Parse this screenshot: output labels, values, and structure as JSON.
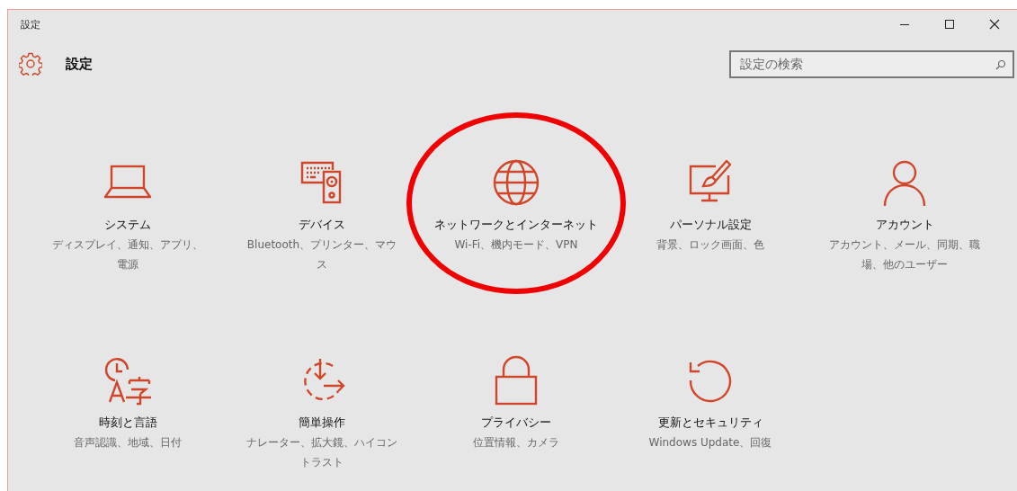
{
  "window": {
    "title": "設定"
  },
  "header": {
    "title": "設定"
  },
  "search": {
    "placeholder": "設定の検索"
  },
  "categories": [
    {
      "title": "システム",
      "description": "ディスプレイ、通知、アプリ、電源",
      "highlighted": false
    },
    {
      "title": "デバイス",
      "description": "Bluetooth、プリンター、マウス",
      "highlighted": false
    },
    {
      "title": "ネットワークとインターネット",
      "description": "Wi-Fi、機内モード、VPN",
      "highlighted": true
    },
    {
      "title": "パーソナル設定",
      "description": "背景、ロック画面、色",
      "highlighted": false
    },
    {
      "title": "アカウント",
      "description": "アカウント、メール、同期、職場、他のユーザー",
      "highlighted": false
    },
    {
      "title": "時刻と言語",
      "description": "音声認識、地域、日付",
      "highlighted": false
    },
    {
      "title": "簡単操作",
      "description": "ナレーター、拡大鏡、ハイコントラスト",
      "highlighted": false
    },
    {
      "title": "プライバシー",
      "description": "位置情報、カメラ",
      "highlighted": false
    },
    {
      "title": "更新とセキュリティ",
      "description": "Windows Update、回復",
      "highlighted": false
    }
  ]
}
